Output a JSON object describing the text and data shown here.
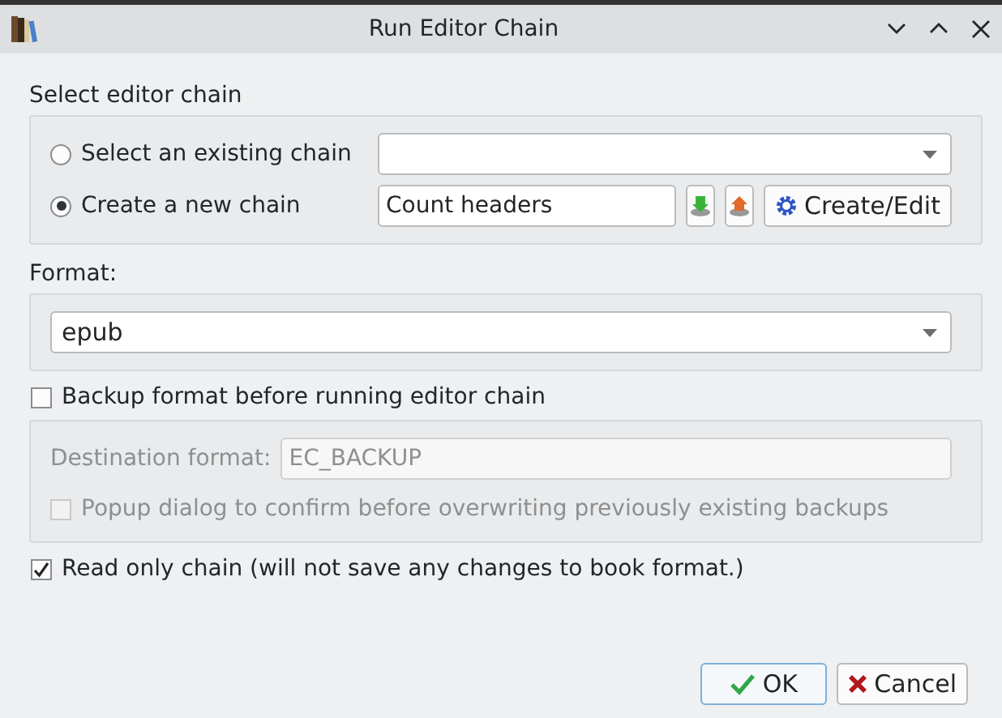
{
  "window": {
    "title": "Run Editor Chain"
  },
  "chain_section": {
    "label": "Select editor chain",
    "options": [
      {
        "kind": "combo",
        "label": "Select an existing chain",
        "selected": false
      },
      {
        "kind": "text",
        "label": "Create a new chain",
        "selected": true,
        "value": "Count headers",
        "button": "Create/Edit"
      }
    ]
  },
  "format": {
    "label": "Format:",
    "value": "epub"
  },
  "backup": {
    "label": "Backup format before running editor chain",
    "checked": false,
    "disabled": true,
    "destination_label": "Destination format:",
    "destination_value": "EC_BACKUP",
    "popup": {
      "label": "Popup dialog to confirm before overwriting previously existing backups",
      "checked": false
    }
  },
  "read_only": {
    "label": "Read only chain (will not save any changes to book format.)",
    "checked": true
  },
  "buttons": [
    {
      "kind": "ok",
      "label": "OK"
    },
    {
      "kind": "cancel",
      "label": "Cancel"
    }
  ]
}
